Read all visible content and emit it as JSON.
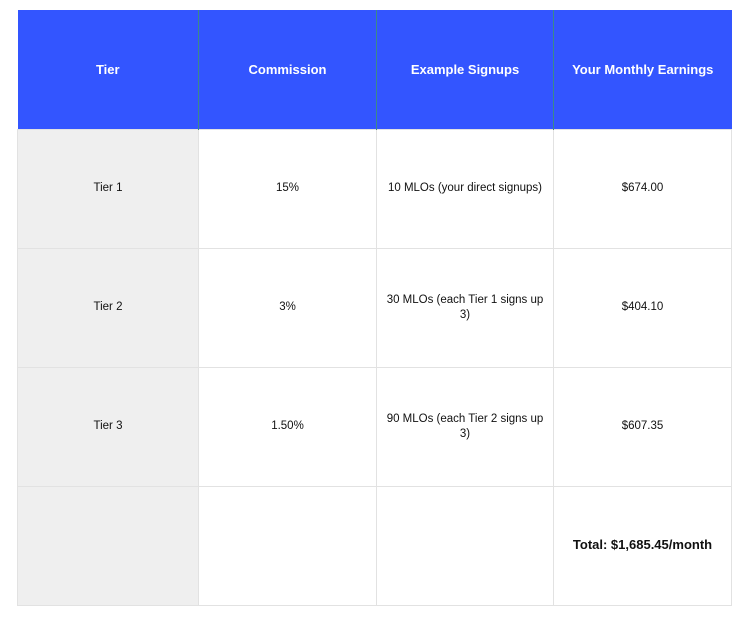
{
  "table": {
    "headers": [
      "Tier",
      "Commission",
      "Example Signups",
      "Your Monthly Earnings"
    ],
    "rows": [
      {
        "tier": "Tier 1",
        "commission": "15%",
        "signups": "10 MLOs (your direct signups)",
        "earnings": "$674.00"
      },
      {
        "tier": "Tier 2",
        "commission": "3%",
        "signups": "30 MLOs (each Tier 1 signs up 3)",
        "earnings": "$404.10"
      },
      {
        "tier": "Tier 3",
        "commission": "1.50%",
        "signups": "90 MLOs (each Tier 2 signs up 3)",
        "earnings": "$607.35"
      }
    ],
    "total": "Total: $1,685.45/month"
  },
  "colors": {
    "header_bg": "#3355ff",
    "header_text": "#ffffff",
    "tier_column_bg": "#efefef",
    "border": "#e2e2e2"
  }
}
